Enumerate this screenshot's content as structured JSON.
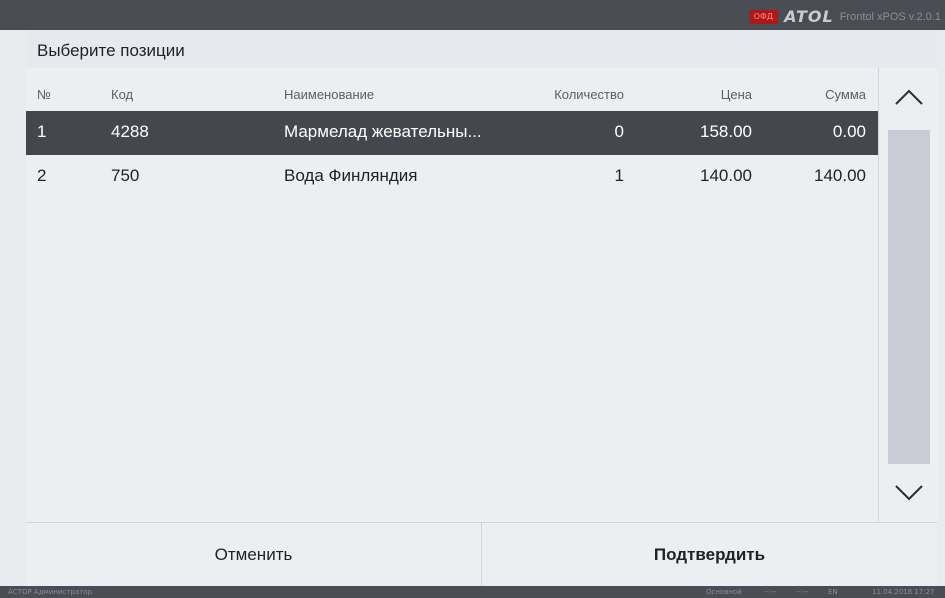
{
  "brand": {
    "badge": "ОФД",
    "logo": "ATOL",
    "product": "Frontol xPOS v.2.0.1"
  },
  "dialog": {
    "title": "Выберите позиции",
    "columns": {
      "no": "№",
      "code": "Код",
      "name": "Наименование",
      "qty": "Количество",
      "price": "Цена",
      "sum": "Сумма"
    },
    "rows": [
      {
        "no": "1",
        "code": "4288",
        "name": "Мармелад жевательны...",
        "qty": "0",
        "price": "158.00",
        "sum": "0.00"
      },
      {
        "no": "2",
        "code": "750",
        "name": "Вода Финляндия",
        "qty": "1",
        "price": "140.00",
        "sum": "140.00"
      }
    ],
    "cancel_label": "Отменить",
    "confirm_label": "Подтвердить"
  },
  "status": {
    "user": "АСТОР Администратор",
    "mode": "Основной",
    "slot1": "--:--",
    "slot2": "--:--",
    "lang": "EN",
    "datetime": "11.04.2018 17:27"
  },
  "icons": {
    "scroll_up": "chevron-up-icon",
    "scroll_down": "chevron-down-icon"
  },
  "colors": {
    "selected_row": "#44474e",
    "ofd_badge": "#b01818",
    "background": "#eceef1"
  }
}
